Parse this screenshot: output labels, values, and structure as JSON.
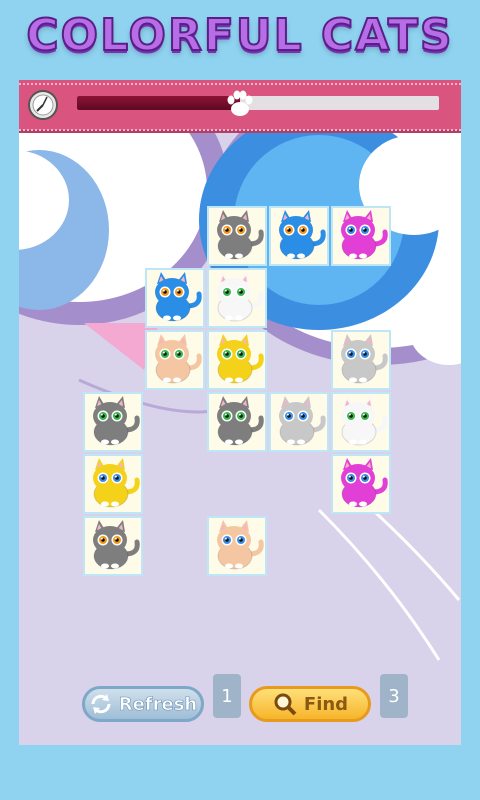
{
  "title": "COLORFUL CATS",
  "timer": {
    "progress": 0.45
  },
  "buttons": {
    "refresh_label": "Refresh",
    "refresh_count": "1",
    "find_label": "Find",
    "find_count": "3"
  },
  "colors": {
    "gray": "#7e7e7e",
    "blue": "#2b8ee6",
    "magenta": "#e23fd6",
    "white": "#f7f7f7",
    "peach": "#f4c7a2",
    "yellow": "#f5d21a",
    "silver": "#c8c8c8"
  },
  "tiles": [
    {
      "row": 0,
      "col": 3,
      "cat": "gray",
      "eyes": "orange"
    },
    {
      "row": 0,
      "col": 4,
      "cat": "blue",
      "eyes": "orange"
    },
    {
      "row": 0,
      "col": 5,
      "cat": "magenta",
      "eyes": "blue"
    },
    {
      "row": 1,
      "col": 2,
      "cat": "blue",
      "eyes": "orange"
    },
    {
      "row": 1,
      "col": 3,
      "cat": "white",
      "eyes": "green"
    },
    {
      "row": 2,
      "col": 2,
      "cat": "peach",
      "eyes": "green"
    },
    {
      "row": 2,
      "col": 3,
      "cat": "yellow",
      "eyes": "green"
    },
    {
      "row": 2,
      "col": 5,
      "cat": "silver",
      "eyes": "blue"
    },
    {
      "row": 3,
      "col": 1,
      "cat": "gray",
      "eyes": "green"
    },
    {
      "row": 3,
      "col": 3,
      "cat": "gray",
      "eyes": "green"
    },
    {
      "row": 3,
      "col": 4,
      "cat": "silver",
      "eyes": "blue"
    },
    {
      "row": 3,
      "col": 5,
      "cat": "white",
      "eyes": "green"
    },
    {
      "row": 4,
      "col": 1,
      "cat": "yellow",
      "eyes": "blue"
    },
    {
      "row": 4,
      "col": 5,
      "cat": "magenta",
      "eyes": "blue"
    },
    {
      "row": 5,
      "col": 1,
      "cat": "gray",
      "eyes": "orange"
    },
    {
      "row": 5,
      "col": 3,
      "cat": "peach",
      "eyes": "blue"
    }
  ]
}
